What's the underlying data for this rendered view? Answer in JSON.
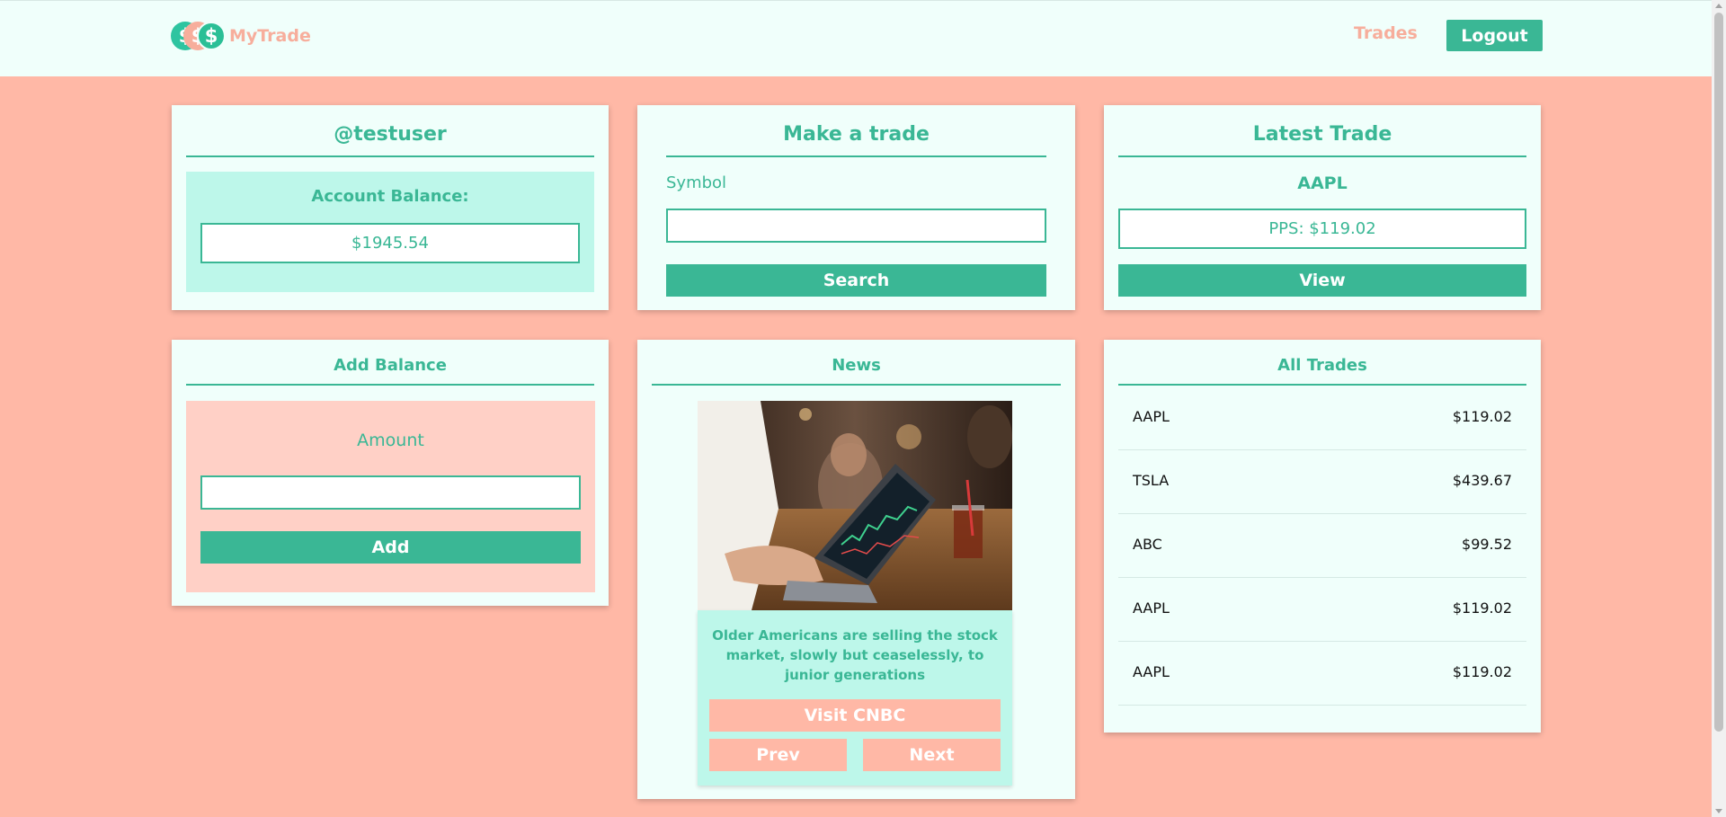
{
  "nav": {
    "brand": "MyTrade",
    "coin_symbol": "$",
    "trades_link": "Trades",
    "logout_label": "Logout"
  },
  "profile": {
    "username": "@testuser",
    "balance_label": "Account Balance:",
    "balance_value": "$1945.54"
  },
  "make_trade": {
    "title": "Make a trade",
    "symbol_label": "Symbol",
    "symbol_value": "",
    "search_label": "Search"
  },
  "latest_trade": {
    "title": "Latest Trade",
    "symbol": "AAPL",
    "pps": "PPS: $119.02",
    "view_label": "View"
  },
  "add_balance": {
    "title": "Add Balance",
    "amount_label": "Amount",
    "amount_value": "",
    "add_label": "Add"
  },
  "news": {
    "title": "News",
    "headline": "Older Americans are selling the stock market, slowly but ceaselessly, to junior generations",
    "visit_label": "Visit CNBC",
    "prev_label": "Prev",
    "next_label": "Next"
  },
  "all_trades": {
    "title": "All Trades",
    "rows": [
      {
        "symbol": "AAPL",
        "price": "$119.02"
      },
      {
        "symbol": "TSLA",
        "price": "$439.67"
      },
      {
        "symbol": "ABC",
        "price": "$99.52"
      },
      {
        "symbol": "AAPL",
        "price": "$119.02"
      },
      {
        "symbol": "AAPL",
        "price": "$119.02"
      }
    ]
  },
  "colors": {
    "accent": "#3AB795",
    "salmon": "#FFB8A6",
    "card_bg": "#F0FFFB",
    "mint_panel": "#BDF7EA",
    "pink_panel": "#FFD0C6"
  }
}
